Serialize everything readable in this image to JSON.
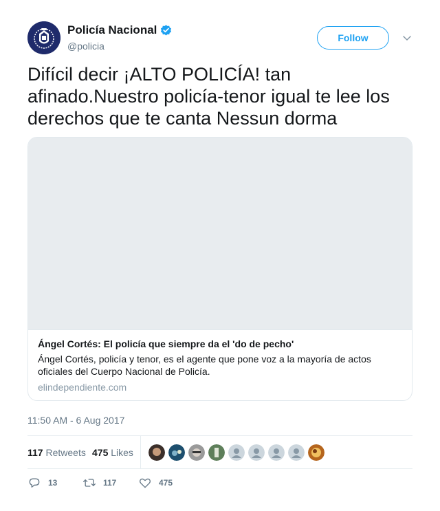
{
  "author": {
    "display_name": "Policía Nacional",
    "handle": "@policia",
    "verified": true,
    "avatar_icon": "police-badge-icon"
  },
  "follow_label": "Follow",
  "tweet": {
    "text": "Difícil decir ¡ALTO POLICÍA! tan afinado.Nuestro policía-tenor igual te lee los derechos que te canta Nessun dorma"
  },
  "card": {
    "title": "Ángel Cortés: El policía que siempre da el 'do de pecho'",
    "description": "Ángel Cortés, policía y tenor, es el agente que pone voz a la mayoría de actos oficiales del Cuerpo Nacional de Policía.",
    "domain": "elindependiente.com"
  },
  "timestamp": "11:50 AM - 6 Aug 2017",
  "stats": {
    "retweets_count": "117",
    "retweets_label": "Retweets",
    "likes_count": "475",
    "likes_label": "Likes"
  },
  "actions": {
    "reply_count": "13",
    "retweet_count": "117",
    "like_count": "475"
  },
  "colors": {
    "accent": "#1da1f2",
    "text": "#14171a",
    "muted": "#657786",
    "avatar_bg": "#1f2b6b"
  }
}
